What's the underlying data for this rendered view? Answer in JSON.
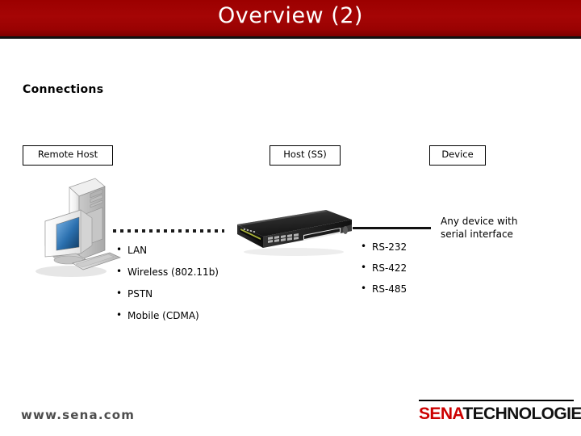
{
  "slide": {
    "title": "Overview (2)",
    "section_heading": "Connections"
  },
  "colors": {
    "banner_red": "#9c0000",
    "logo_red": "#cc0000",
    "footer_gray": "#4d4d4d",
    "text_black": "#000000"
  },
  "diagram": {
    "boxes": [
      {
        "id": "remote-host",
        "label": "Remote Host"
      },
      {
        "id": "host-ss",
        "label": "Host (SS)"
      },
      {
        "id": "device",
        "label": "Device"
      }
    ],
    "connection_types": [
      {
        "label": "LAN"
      },
      {
        "label": "Wireless (802.11b)"
      },
      {
        "label": "PSTN"
      },
      {
        "label": "Mobile (CDMA)"
      }
    ],
    "serial_types": [
      {
        "label": "RS-232"
      },
      {
        "label": "RS-422"
      },
      {
        "label": "RS-485"
      }
    ],
    "device_caption": {
      "line1": "Any device with",
      "line2": "serial interface"
    }
  },
  "footer": {
    "url": "www.sena.com",
    "logo_primary": "SENA",
    "logo_secondary": "TECHNOLOGIES"
  }
}
